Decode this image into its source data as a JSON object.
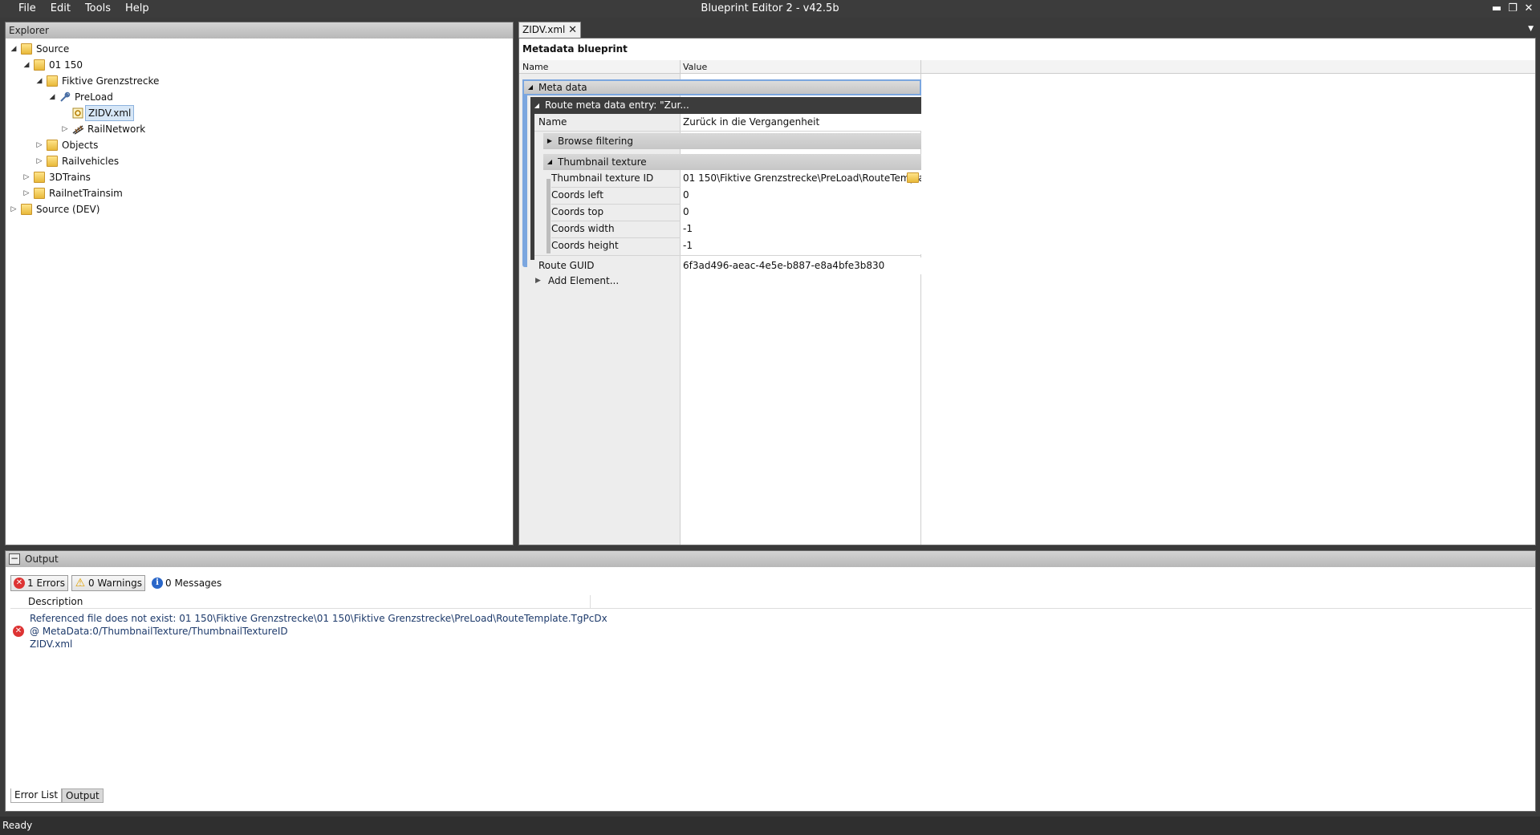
{
  "window": {
    "title": "Blueprint Editor 2 - v42.5b",
    "minimize": "▬",
    "maximize": "❐",
    "close": "✕"
  },
  "menu": [
    "File",
    "Edit",
    "Tools",
    "Help"
  ],
  "explorer": {
    "title": "Explorer",
    "tree": [
      {
        "label": "Source",
        "expander": "◢",
        "icon": "folder-icon"
      },
      {
        "label": "01 150",
        "expander": "◢",
        "icon": "folder-icon"
      },
      {
        "label": "Fiktive Grenzstrecke",
        "expander": "◢",
        "icon": "folder-icon"
      },
      {
        "label": "PreLoad",
        "expander": "◢",
        "icon": "preload-icon"
      },
      {
        "label": "ZIDV.xml",
        "expander": "",
        "icon": "xml-file-icon"
      },
      {
        "label": "RailNetwork",
        "expander": "▷",
        "icon": "railnetwork-icon"
      },
      {
        "label": "Objects",
        "expander": "▷",
        "icon": "folder-icon"
      },
      {
        "label": "Railvehicles",
        "expander": "▷",
        "icon": "folder-icon"
      },
      {
        "label": "3DTrains",
        "expander": "▷",
        "icon": "folder-icon"
      },
      {
        "label": "RailnetTrainsim",
        "expander": "▷",
        "icon": "folder-icon"
      },
      {
        "label": "Source (DEV)",
        "expander": "▷",
        "icon": "folder-icon"
      }
    ]
  },
  "document": {
    "tab_label": "ZIDV.xml",
    "tab_close": "✕",
    "title": "Metadata blueprint",
    "columns": {
      "name": "Name",
      "value": "Value"
    },
    "meta_group": "Meta data",
    "route_group": "Route meta data entry: \"Zur...",
    "name_row": {
      "name": "Name",
      "value": "Zurück in die Vergangenheit"
    },
    "browse_filtering": "Browse filtering",
    "thumbnail_group": "Thumbnail texture",
    "thumbnail_rows": [
      {
        "name": "Thumbnail texture ID",
        "value": "01 150\\Fiktive Grenzstrecke\\PreLoad\\RouteTemplat"
      },
      {
        "name": "Coords left",
        "value": "0"
      },
      {
        "name": "Coords top",
        "value": "0"
      },
      {
        "name": "Coords width",
        "value": "-1"
      },
      {
        "name": "Coords height",
        "value": "-1"
      }
    ],
    "route_guid": {
      "name": "Route GUID",
      "value": "6f3ad496-aeac-4e5e-b887-e8a4bfe3b830"
    },
    "add_element": "Add Element..."
  },
  "output": {
    "title": "Output",
    "filters": {
      "errors": "1 Errors",
      "warnings": "0 Warnings",
      "messages": "0 Messages"
    },
    "description_header": "Description",
    "error": {
      "line1": "Referenced file does not exist: 01 150\\Fiktive Grenzstrecke\\01 150\\Fiktive Grenzstrecke\\PreLoad\\RouteTemplate.TgPcDx",
      "line2": "@ MetaData:0/ThumbnailTexture/ThumbnailTextureID",
      "line3": "ZIDV.xml"
    },
    "tabs": [
      "Error List",
      "Output"
    ]
  },
  "status": "Ready",
  "colors": {
    "titlebar": "#3c3c3c",
    "accent": "#7ba6df",
    "error": "#d33333",
    "warning": "#e0a000",
    "info": "#2a67c9"
  }
}
